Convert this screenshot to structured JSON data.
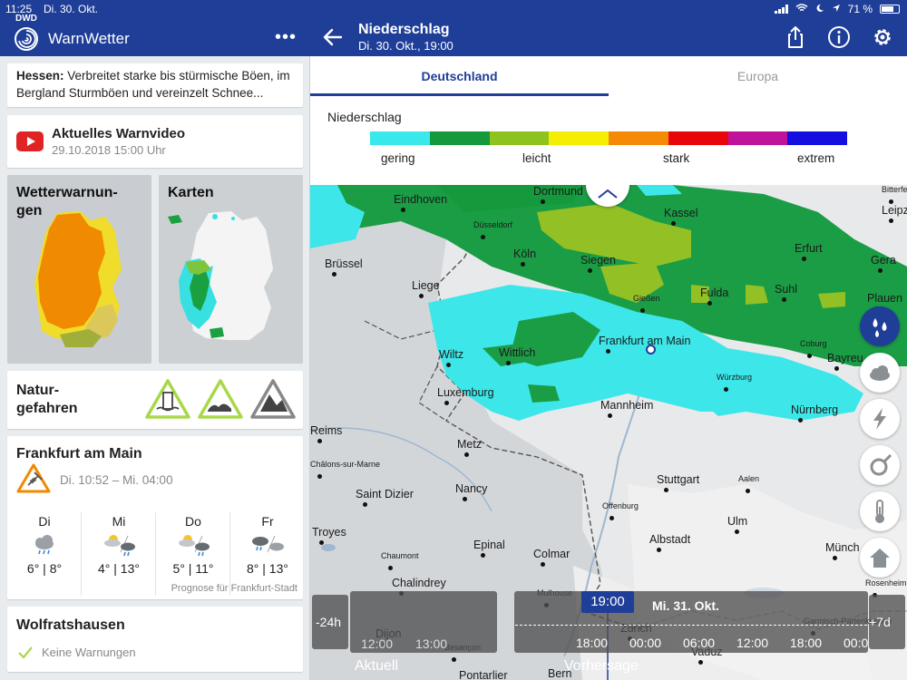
{
  "status": {
    "time": "11:25",
    "date": "Di. 30. Okt.",
    "battery": "71 %"
  },
  "app": {
    "logo_label": "DWD",
    "title": "WarnWetter",
    "more": "•••"
  },
  "header": {
    "title": "Niederschlag",
    "subtitle": "Di. 30. Okt., 19:00"
  },
  "warning": {
    "region": "Hessen:",
    "text": " Verbreitet starke bis stürmische Böen, im Bergland Sturmböen und vereinzelt Schnee..."
  },
  "video": {
    "title": "Aktuelles Warnvideo",
    "date": "29.10.2018 15:00 Uhr"
  },
  "tiles": {
    "warnings": "Wetterwarnun-\ngen",
    "maps": "Karten"
  },
  "natur": {
    "label": "Natur-\ngefahren"
  },
  "city": {
    "name": "Frankfurt am Main",
    "warn_time": "Di. 10:52 – Mi. 04:00",
    "days": [
      {
        "name": "Di",
        "temps": "6° | 8°"
      },
      {
        "name": "Mi",
        "temps": "4° | 13°"
      },
      {
        "name": "Do",
        "temps": "5° | 11°"
      },
      {
        "name": "Fr",
        "temps": "8° | 13°"
      }
    ],
    "forecast_note": "Prognose für Frankfurt-Stadt"
  },
  "wolf": {
    "name": "Wolfratshausen",
    "status": "Keine Warnungen"
  },
  "tabs": [
    {
      "label": "Deutschland"
    },
    {
      "label": "Europa"
    }
  ],
  "legend": {
    "title": "Niederschlag",
    "colors": [
      "#38e8ea",
      "#149a3c",
      "#8ec21c",
      "#f6ed04",
      "#f58a07",
      "#e8060b",
      "#c0139b",
      "#140fe0"
    ],
    "labels": [
      "gering",
      "leicht",
      "stark",
      "extrem"
    ]
  },
  "map": {
    "cities": [
      {
        "name": "Eindhoven"
      },
      {
        "name": "Dortmund"
      },
      {
        "name": "Düsseldorf"
      },
      {
        "name": "Kassel"
      },
      {
        "name": "Leipz"
      },
      {
        "name": "Brüssel"
      },
      {
        "name": "Köln"
      },
      {
        "name": "Siegen"
      },
      {
        "name": "Erfurt"
      },
      {
        "name": "Gera"
      },
      {
        "name": "Liege"
      },
      {
        "name": "Gießen"
      },
      {
        "name": "Fulda"
      },
      {
        "name": "Suhl"
      },
      {
        "name": "Plauen"
      },
      {
        "name": "Wiltz"
      },
      {
        "name": "Wittlich"
      },
      {
        "name": "Frankfurt am Main"
      },
      {
        "name": "Bayreu"
      },
      {
        "name": "Luxemburg"
      },
      {
        "name": "Mannheim"
      },
      {
        "name": "Würzburg"
      },
      {
        "name": "Nürnberg"
      },
      {
        "name": "Reims"
      },
      {
        "name": "Metz"
      },
      {
        "name": "Châlons-sur-Marne"
      },
      {
        "name": "Nancy"
      },
      {
        "name": "Saint Dizier"
      },
      {
        "name": "Stuttgart"
      },
      {
        "name": "Aalen"
      },
      {
        "name": "Offenburg"
      },
      {
        "name": "Troyes"
      },
      {
        "name": "Epinal"
      },
      {
        "name": "Ulm"
      },
      {
        "name": "Chaumont"
      },
      {
        "name": "Colmar"
      },
      {
        "name": "Albstadt"
      },
      {
        "name": "Münch"
      },
      {
        "name": "Chalindrey"
      },
      {
        "name": "Mulhouse"
      },
      {
        "name": "Dijon"
      },
      {
        "name": "Zürich"
      },
      {
        "name": "Besançon"
      },
      {
        "name": "Vaduz"
      },
      {
        "name": "Garmisch-Partenkirchen"
      },
      {
        "name": "Rosenheim"
      },
      {
        "name": "Pontarlier"
      },
      {
        "name": "Bern"
      },
      {
        "name": "Coburg"
      },
      {
        "name": "Bitterfeld"
      }
    ]
  },
  "timeline": {
    "past_label": "-24h",
    "past_times": [
      "12:00",
      "13:00"
    ],
    "current": "19:00",
    "date_label": "Mi. 31. Okt.",
    "future_label": "+7d",
    "times": [
      "18:00",
      "00:00",
      "06:00",
      "12:00",
      "18:00",
      "00:0"
    ],
    "aktuell": "Aktuell",
    "vorhersage": "Vorhersage"
  }
}
